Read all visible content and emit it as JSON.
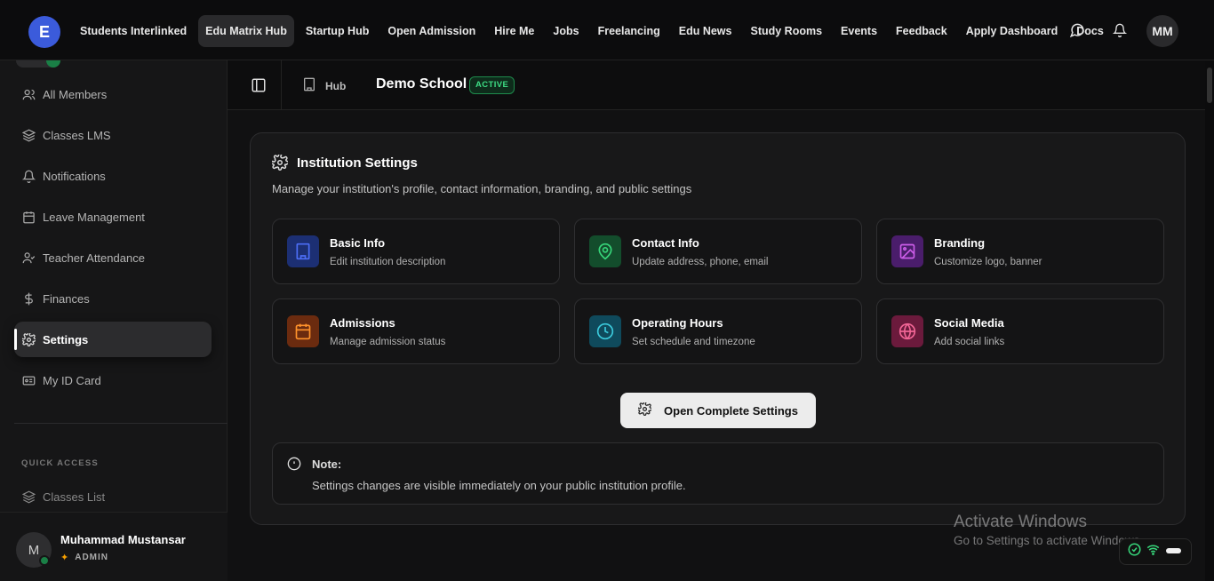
{
  "app": {
    "logo_letter": "E",
    "nav": [
      {
        "label": "Students Interlinked"
      },
      {
        "label": "Edu Matrix Hub",
        "active": true
      },
      {
        "label": "Startup Hub"
      },
      {
        "label": "Open Admission"
      },
      {
        "label": "Hire Me"
      },
      {
        "label": "Jobs"
      },
      {
        "label": "Freelancing"
      },
      {
        "label": "Edu News"
      },
      {
        "label": "Study Rooms"
      },
      {
        "label": "Events"
      },
      {
        "label": "Feedback"
      },
      {
        "label": "Apply Dashboard"
      },
      {
        "label": "Docs"
      }
    ],
    "user_initials": "MM"
  },
  "sidebar": {
    "items": [
      {
        "label": "All Members",
        "icon": "users-icon"
      },
      {
        "label": "Classes LMS",
        "icon": "layers-icon"
      },
      {
        "label": "Notifications",
        "icon": "bell-icon"
      },
      {
        "label": "Leave Management",
        "icon": "calendar-icon"
      },
      {
        "label": "Teacher Attendance",
        "icon": "user-check-icon"
      },
      {
        "label": "Finances",
        "icon": "dollar-icon"
      },
      {
        "label": "Settings",
        "icon": "gear-icon",
        "active": true
      },
      {
        "label": "My ID Card",
        "icon": "id-card-icon"
      }
    ],
    "quick_access_title": "QUICK ACCESS",
    "quick_access_items": [
      {
        "label": "Classes List",
        "icon": "layers-icon"
      }
    ],
    "user": {
      "avatar_letter": "M",
      "name": "Muhammad Mustansar",
      "role": "ADMIN"
    }
  },
  "subheader": {
    "hub_label": "Hub",
    "school_name": "Demo School",
    "status_badge": "ACTIVE"
  },
  "settings": {
    "title": "Institution Settings",
    "description": "Manage your institution's profile, contact information, branding, and public settings",
    "tiles": [
      {
        "title": "Basic Info",
        "subtitle": "Edit institution description",
        "icon": "building-icon",
        "color": "#4c6ef5",
        "bg": "#1c2f73"
      },
      {
        "title": "Contact Info",
        "subtitle": "Update address, phone, email",
        "icon": "map-pin-icon",
        "color": "#37d67a",
        "bg": "#134d2c"
      },
      {
        "title": "Branding",
        "subtitle": "Customize logo, banner",
        "icon": "image-icon",
        "color": "#cc5de8",
        "bg": "#4a1d6b"
      },
      {
        "title": "Admissions",
        "subtitle": "Manage admission status",
        "icon": "calendar-icon",
        "color": "#ff922b",
        "bg": "#6b2b0f"
      },
      {
        "title": "Operating Hours",
        "subtitle": "Set schedule and timezone",
        "icon": "clock-icon",
        "color": "#3bc9db",
        "bg": "#0f4a5c"
      },
      {
        "title": "Social Media",
        "subtitle": "Add social links",
        "icon": "globe-icon",
        "color": "#f06595",
        "bg": "#6b1a3c"
      }
    ],
    "open_button": "Open Complete Settings",
    "note_title": "Note:",
    "note_text": "Settings changes are visible immediately on your public institution profile."
  },
  "os": {
    "watermark_title": "Activate Windows",
    "watermark_sub": "Go to Settings to activate Windows."
  }
}
